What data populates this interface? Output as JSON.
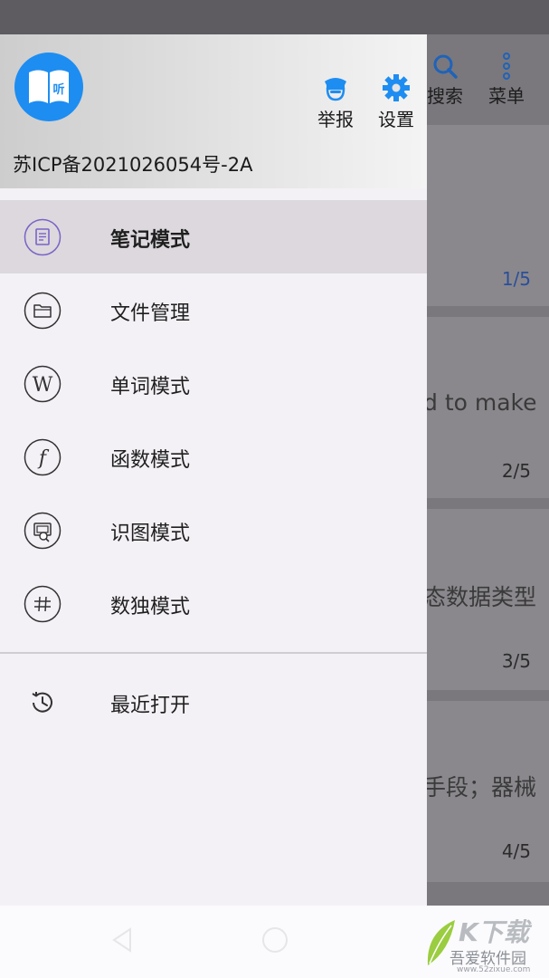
{
  "background": {
    "toolbar": {
      "search_label": "搜索",
      "menu_label": "菜单"
    },
    "cards": [
      {
        "text": "",
        "counter": "1/5"
      },
      {
        "text": "d to make",
        "counter": "2/5"
      },
      {
        "text": "态数据类型",
        "counter": "3/5"
      },
      {
        "text": "手段；器械",
        "counter": "4/5"
      }
    ]
  },
  "drawer": {
    "header": {
      "logo_text": "听",
      "report_label": "举报",
      "settings_label": "设置",
      "icp": "苏ICP备2021026054号-2A"
    },
    "items": [
      {
        "label": "笔记模式",
        "icon": "note-icon",
        "selected": true
      },
      {
        "label": "文件管理",
        "icon": "folder-icon",
        "selected": false
      },
      {
        "label": "单词模式",
        "icon": "word-w-icon",
        "selected": false
      },
      {
        "label": "函数模式",
        "icon": "function-f-icon",
        "selected": false
      },
      {
        "label": "识图模式",
        "icon": "image-recognition-icon",
        "selected": false
      },
      {
        "label": "数独模式",
        "icon": "sudoku-grid-icon",
        "selected": false
      }
    ],
    "recent": {
      "label": "最近打开",
      "icon": "history-icon"
    }
  },
  "watermark": {
    "big": "K下载",
    "cn": "吾爱软件园",
    "url": "www.52zixue.com"
  },
  "colors": {
    "accent": "#1d8df2",
    "icon_purple": "#7a63c7",
    "selected_bg": "#dcd8dd"
  }
}
